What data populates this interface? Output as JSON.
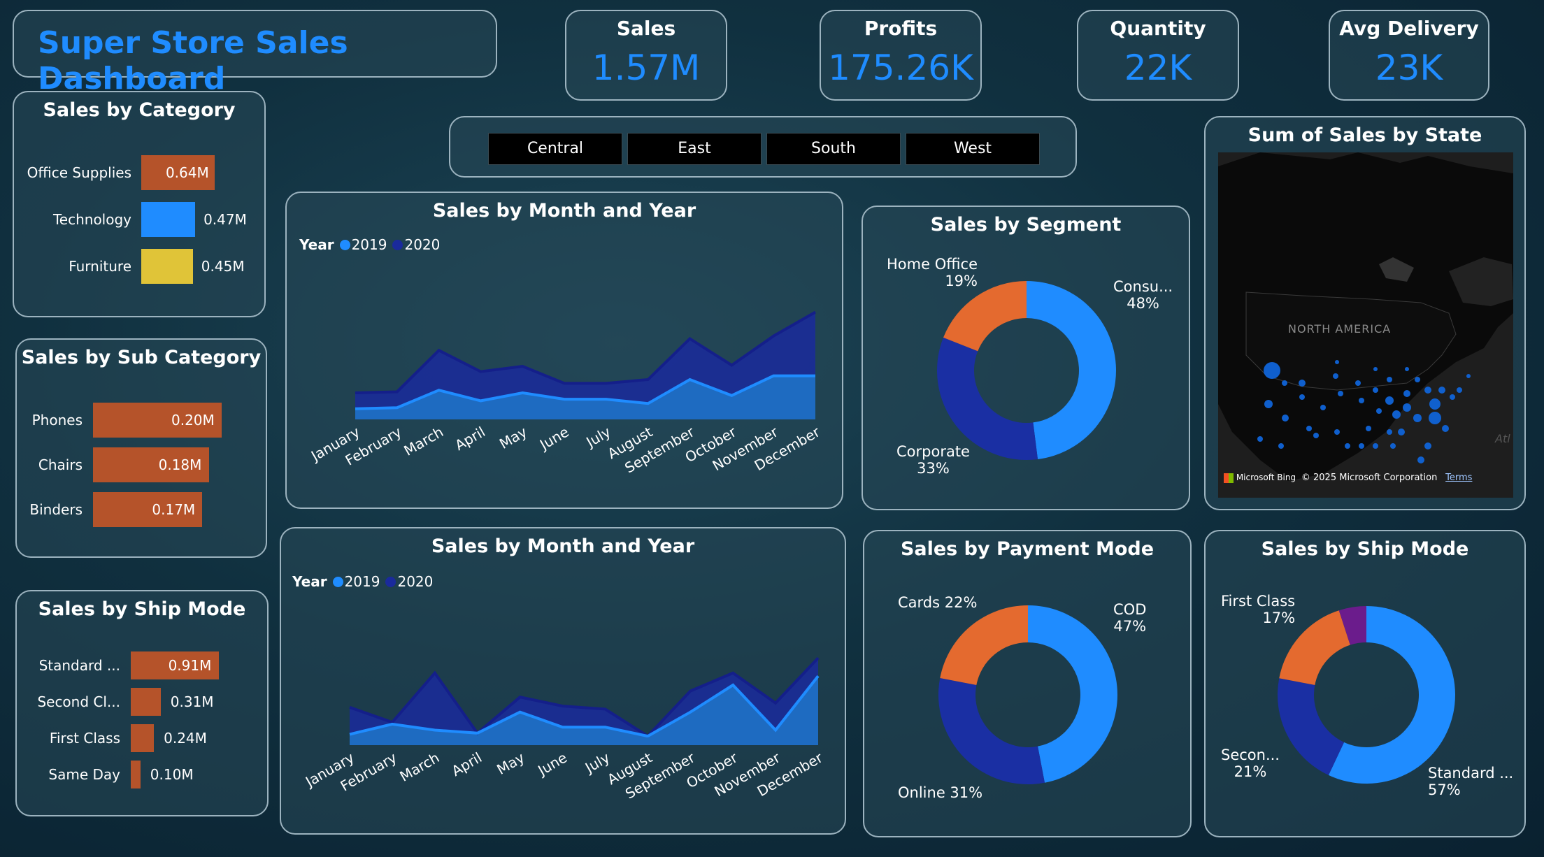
{
  "title": "Super Store Sales Dashboard",
  "kpis": {
    "sales": {
      "label": "Sales",
      "value": "1.57M"
    },
    "profits": {
      "label": "Profits",
      "value": "175.26K"
    },
    "quantity": {
      "label": "Quantity",
      "value": "22K"
    },
    "avg_delivery": {
      "label": "Avg Delivery",
      "value": "23K"
    }
  },
  "regions": [
    "Central",
    "East",
    "South",
    "West"
  ],
  "category": {
    "title": "Sales by Category",
    "items": [
      {
        "label": "Office Supplies",
        "value": 0.64,
        "text": "0.64M",
        "color": "#b5532a"
      },
      {
        "label": "Technology",
        "value": 0.47,
        "text": "0.47M",
        "color": "#1f8cff"
      },
      {
        "label": "Furniture",
        "value": 0.45,
        "text": "0.45M",
        "color": "#e0c438"
      }
    ]
  },
  "subcategory": {
    "title": "Sales by Sub Category",
    "items": [
      {
        "label": "Phones",
        "value": 0.2,
        "text": "0.20M"
      },
      {
        "label": "Chairs",
        "value": 0.18,
        "text": "0.18M"
      },
      {
        "label": "Binders",
        "value": 0.17,
        "text": "0.17M"
      }
    ],
    "color": "#b5532a"
  },
  "shipbar": {
    "title": "Sales by Ship Mode",
    "items": [
      {
        "label": "Standard ...",
        "value": 0.91,
        "text": "0.91M"
      },
      {
        "label": "Second Cl...",
        "value": 0.31,
        "text": "0.31M"
      },
      {
        "label": "First Class",
        "value": 0.24,
        "text": "0.24M"
      },
      {
        "label": "Same Day",
        "value": 0.1,
        "text": "0.10M"
      }
    ],
    "color": "#b5532a"
  },
  "area1": {
    "title": "Sales by Month and Year",
    "legend_title": "Year",
    "series_names": [
      "2019",
      "2020"
    ],
    "colors": [
      "#1f8cff",
      "#1a2a9c"
    ]
  },
  "area2": {
    "title": "Sales by Month and Year",
    "legend_title": "Year",
    "series_names": [
      "2019",
      "2020"
    ],
    "colors": [
      "#1f8cff",
      "#1a2a9c"
    ]
  },
  "segment": {
    "title": "Sales by Segment",
    "labels": {
      "consumer": "Consu...",
      "consumer_pct": "48%",
      "home": "Home Office",
      "home_pct": "19%",
      "corporate": "Corporate",
      "corporate_pct": "33%"
    }
  },
  "payment": {
    "title": "Sales by Payment Mode",
    "labels": {
      "cod": "COD",
      "cod_pct": "47%",
      "cards": "Cards 22%",
      "online": "Online 31%"
    }
  },
  "shipdonut": {
    "title": "Sales by Ship Mode",
    "labels": {
      "first": "First Class",
      "first_pct": "17%",
      "second": "Secon...",
      "second_pct": "21%",
      "standard": "Standard ...",
      "standard_pct": "57%"
    }
  },
  "map": {
    "title": "Sum of Sales by State",
    "region_label": "NORTH AMERICA",
    "ocean_label": "Atl",
    "attribution": "Microsoft Bing",
    "copyright": "© 2025 Microsoft Corporation",
    "terms": "Terms"
  },
  "chart_data": [
    {
      "type": "bar",
      "title": "Sales by Category",
      "categories": [
        "Office Supplies",
        "Technology",
        "Furniture"
      ],
      "values": [
        0.64,
        0.47,
        0.45
      ]
    },
    {
      "type": "bar",
      "title": "Sales by Sub Category",
      "categories": [
        "Phones",
        "Chairs",
        "Binders"
      ],
      "values": [
        0.2,
        0.18,
        0.17
      ]
    },
    {
      "type": "bar",
      "title": "Sales by Ship Mode",
      "categories": [
        "Standard ...",
        "Second Cl...",
        "First Class",
        "Same Day"
      ],
      "values": [
        0.91,
        0.31,
        0.24,
        0.1
      ]
    },
    {
      "type": "area",
      "title": "Sales by Month and Year",
      "categories": [
        "January",
        "February",
        "March",
        "April",
        "May",
        "June",
        "July",
        "August",
        "September",
        "October",
        "November",
        "December"
      ],
      "series": [
        {
          "name": "2019",
          "values": [
            20,
            22,
            55,
            35,
            50,
            38,
            38,
            30,
            75,
            45,
            82,
            82
          ]
        },
        {
          "name": "2020",
          "values": [
            30,
            30,
            75,
            55,
            50,
            30,
            30,
            45,
            77,
            57,
            75,
            120
          ]
        }
      ]
    },
    {
      "type": "area",
      "title": "Sales by Month and Year",
      "categories": [
        "January",
        "February",
        "March",
        "April",
        "May",
        "June",
        "July",
        "August",
        "September",
        "October",
        "November",
        "December"
      ],
      "series": [
        {
          "name": "2019",
          "values": [
            18,
            35,
            25,
            20,
            55,
            30,
            30,
            15,
            55,
            100,
            25,
            115
          ]
        },
        {
          "name": "2020",
          "values": [
            45,
            3,
            95,
            0,
            25,
            35,
            30,
            0,
            35,
            20,
            45,
            30
          ]
        }
      ]
    },
    {
      "type": "pie",
      "title": "Sales by Segment",
      "categories": [
        "Consu...",
        "Corporate",
        "Home Office"
      ],
      "values": [
        48,
        33,
        19
      ]
    },
    {
      "type": "pie",
      "title": "Sales by Payment Mode",
      "categories": [
        "COD",
        "Online",
        "Cards"
      ],
      "values": [
        47,
        31,
        22
      ]
    },
    {
      "type": "pie",
      "title": "Sales by Ship Mode",
      "categories": [
        "Standard ...",
        "Secon...",
        "First Class",
        "Same Day"
      ],
      "values": [
        57,
        21,
        17,
        5
      ]
    }
  ]
}
